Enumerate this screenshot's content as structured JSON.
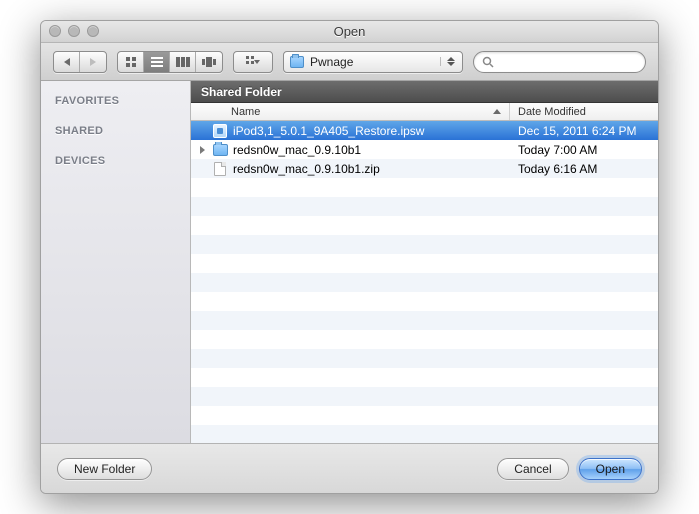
{
  "window": {
    "title": "Open"
  },
  "toolbar": {
    "path_label": "Pwnage",
    "search_placeholder": ""
  },
  "sidebar": {
    "categories": [
      "FAVORITES",
      "SHARED",
      "DEVICES"
    ]
  },
  "pathbar": {
    "label": "Shared Folder"
  },
  "columns": {
    "name": "Name",
    "date": "Date Modified"
  },
  "files": [
    {
      "icon": "ipsw",
      "expandable": false,
      "selected": true,
      "name": "iPod3,1_5.0.1_9A405_Restore.ipsw",
      "date": "Dec 15, 2011 6:24 PM"
    },
    {
      "icon": "folder",
      "expandable": true,
      "selected": false,
      "name": "redsn0w_mac_0.9.10b1",
      "date": "Today 7:00 AM"
    },
    {
      "icon": "file",
      "expandable": false,
      "selected": false,
      "name": "redsn0w_mac_0.9.10b1.zip",
      "date": "Today 6:16 AM"
    }
  ],
  "footer": {
    "new_folder": "New Folder",
    "cancel": "Cancel",
    "open": "Open"
  }
}
